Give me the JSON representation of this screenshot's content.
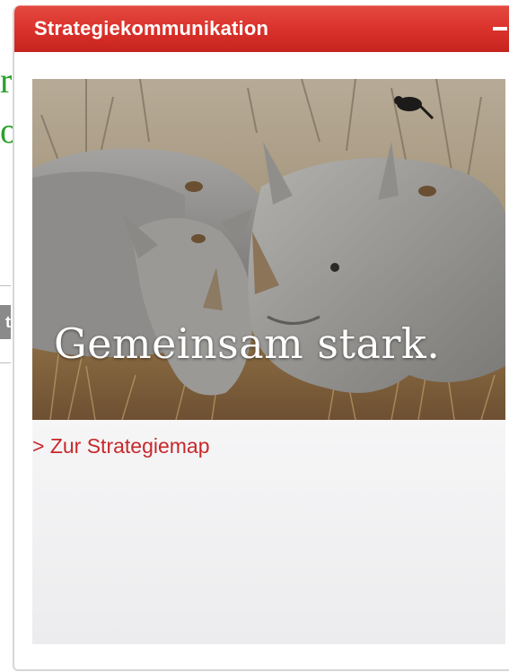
{
  "background": {
    "letters": [
      "r",
      "o"
    ],
    "box_text": "t"
  },
  "widget": {
    "title": "Strategiekommunikation",
    "collapse_label": "–",
    "image": {
      "caption": "Gemeinsam stark.",
      "subject": "rhinos-with-birds-photo"
    },
    "link_label": "> Zur Strategiemap"
  },
  "colors": {
    "header_red": "#d9302a",
    "link_red": "#c8282a",
    "fragment_green": "#2aa02a"
  }
}
